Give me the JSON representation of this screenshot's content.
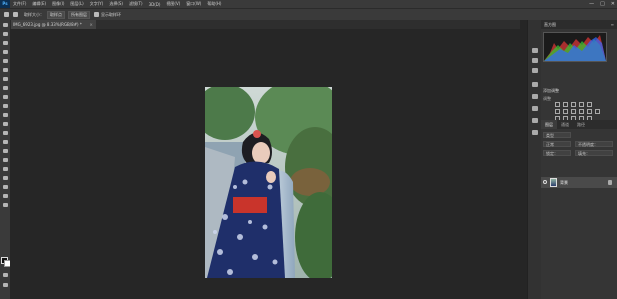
{
  "menubar": {
    "logo": "Ps",
    "items": [
      "文件(F)",
      "编辑(E)",
      "图像(I)",
      "图层(L)",
      "文字(Y)",
      "选择(S)",
      "滤镜(T)",
      "3D(D)",
      "视图(V)",
      "窗口(W)",
      "帮助(H)"
    ],
    "minimize": "—",
    "maximize": "□",
    "close": "✕"
  },
  "options": {
    "sample_size": "取样大小：",
    "sample_value": "取样点",
    "sample_all": "所有图层",
    "show_ring": "显示取样环"
  },
  "document": {
    "tab_label": "IMG_6923.jpg @ 8.33%(RGB/8#) *",
    "close": "×"
  },
  "panels": {
    "histogram_tab": "直方图",
    "adjustments_title": "添加调整",
    "adjustments_sub": "调整",
    "layers_tabs": [
      "图层",
      "通道",
      "路径"
    ],
    "kind_label": "类型",
    "blend_mode": "正常",
    "opacity_label": "不透明度：",
    "lock_label": "锁定：",
    "fill_label": "填充：",
    "layer_name": "背景",
    "menu": "≡"
  },
  "colors": {
    "canvas_bg": "#262626",
    "panel_bg": "#353535",
    "chrome_bg": "#3a3a3a",
    "foreground": "#111111",
    "background": "#ffffff"
  }
}
